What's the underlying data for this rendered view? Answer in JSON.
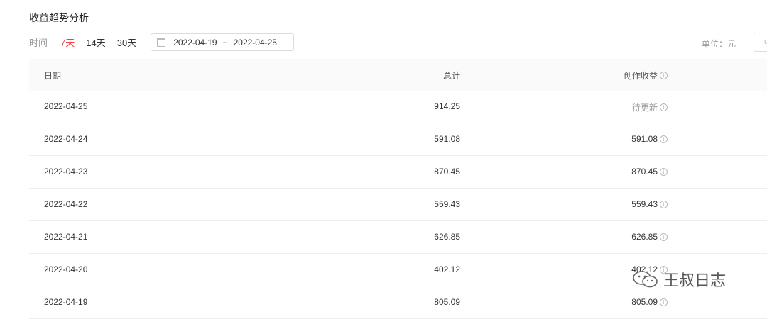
{
  "page": {
    "title": "收益趋势分析"
  },
  "filters": {
    "label": "时间",
    "ranges": [
      {
        "label": "7天",
        "active": true
      },
      {
        "label": "14天",
        "active": false
      },
      {
        "label": "30天",
        "active": false
      }
    ],
    "date_start": "2022-04-19",
    "date_sep": "~",
    "date_end": "2022-04-25",
    "unit_label": "单位：元",
    "unit_select_partial": "u"
  },
  "table": {
    "headers": {
      "date": "日期",
      "total": "总计",
      "income": "创作收益"
    },
    "info_glyph": "i",
    "rows": [
      {
        "date": "2022-04-25",
        "total": "914.25",
        "income": "待更新"
      },
      {
        "date": "2022-04-24",
        "total": "591.08",
        "income": "591.08"
      },
      {
        "date": "2022-04-23",
        "total": "870.45",
        "income": "870.45"
      },
      {
        "date": "2022-04-22",
        "total": "559.43",
        "income": "559.43"
      },
      {
        "date": "2022-04-21",
        "total": "626.85",
        "income": "626.85"
      },
      {
        "date": "2022-04-20",
        "total": "402.12",
        "income": "402.12"
      },
      {
        "date": "2022-04-19",
        "total": "805.09",
        "income": "805.09"
      }
    ]
  },
  "watermark": {
    "text": "王叔日志",
    "icon": "wechat-icon"
  },
  "colors": {
    "accent": "#f04142",
    "header_bg": "#fafafa",
    "border": "#eeeeee"
  }
}
